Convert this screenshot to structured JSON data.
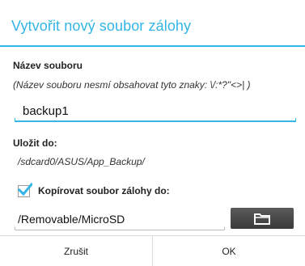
{
  "dialog": {
    "title": "Vytvořit nový soubor zálohy",
    "filename_label": "Název souboru",
    "filename_hint": "(Název souboru nesmí obsahovat tyto znaky: \\/:*?\"<>| )",
    "filename_value": "backup1",
    "save_to_label": "Uložit do:",
    "save_to_path": "/sdcard0/ASUS/App_Backup/",
    "copy_checkbox_label": "Kopírovat soubor zálohy do:",
    "copy_checkbox_checked": true,
    "copy_destination": "/Removable/MicroSD",
    "folder_button_icon": "folder-icon",
    "cancel_label": "Zrušit",
    "ok_label": "OK"
  },
  "colors": {
    "accent": "#33b5e5",
    "button_dark": "#4a4a4a"
  }
}
